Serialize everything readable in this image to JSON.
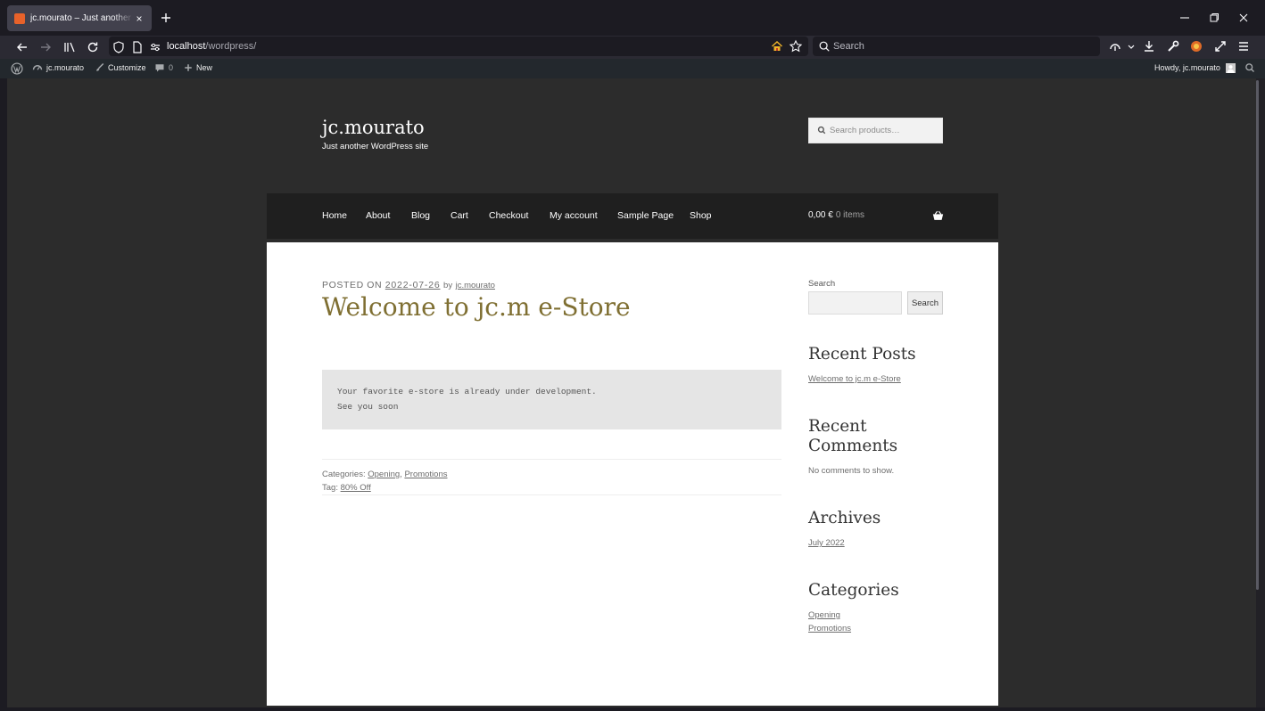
{
  "browser": {
    "tab_title": "jc.mourato – Just another WordPress site",
    "url_host": "localhost",
    "url_path": "/wordpress/",
    "search_placeholder": "Search"
  },
  "admin_bar": {
    "site_name": "jc.mourato",
    "customize": "Customize",
    "comments_count": "0",
    "new": "New",
    "howdy": "Howdy, jc.mourato"
  },
  "header": {
    "site_title": "jc.mourato",
    "tagline": "Just another WordPress site",
    "product_search_placeholder": "Search products…"
  },
  "menu": {
    "items": [
      "Home",
      "About",
      "Blog",
      "Cart",
      "Checkout",
      "My account",
      "Sample Page",
      "Shop"
    ],
    "cart_amount": "0,00 €",
    "cart_count": "0 items"
  },
  "post": {
    "posted_on_label": "POSTED ON",
    "date": "2022-07-26",
    "by": "by",
    "author": "jc.mourato",
    "title": "Welcome to jc.m e-Store",
    "code_lines": [
      "Your favorite e-store is already under development.",
      "See you soon"
    ],
    "categories_label": "Categories:",
    "categories": [
      "Opening",
      "Promotions"
    ],
    "tag_label": "Tag:",
    "tag": "80% Off"
  },
  "sidebar": {
    "search_label": "Search",
    "search_button": "Search",
    "recent_posts_title": "Recent Posts",
    "recent_post": "Welcome to jc.m e-Store",
    "recent_comments_title_line1": "Recent",
    "recent_comments_title_line2": "Comments",
    "no_comments": "No comments to show.",
    "archives_title": "Archives",
    "archive_month": "July 2022",
    "categories_title": "Categories",
    "categories": [
      "Opening",
      "Promotions"
    ]
  }
}
